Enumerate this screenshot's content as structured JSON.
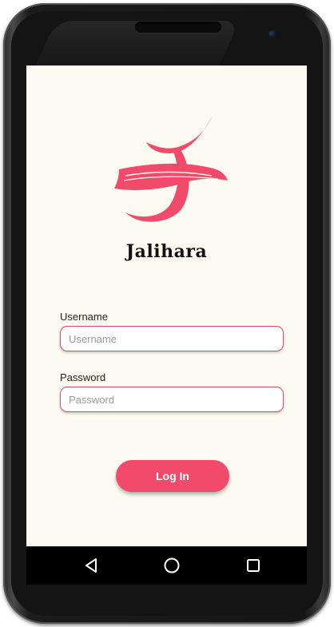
{
  "app": {
    "brand_name": "Jalihara",
    "accent_color": "#f24a6a"
  },
  "form": {
    "username_label": "Username",
    "username_placeholder": "Username",
    "username_value": "",
    "password_label": "Password",
    "password_placeholder": "Password",
    "password_value": "",
    "login_button_label": "Log In"
  },
  "navbar": {
    "buttons": [
      {
        "name": "back",
        "icon": "triangle-back-icon"
      },
      {
        "name": "home",
        "icon": "circle-home-icon"
      },
      {
        "name": "recents",
        "icon": "square-recents-icon"
      }
    ]
  }
}
